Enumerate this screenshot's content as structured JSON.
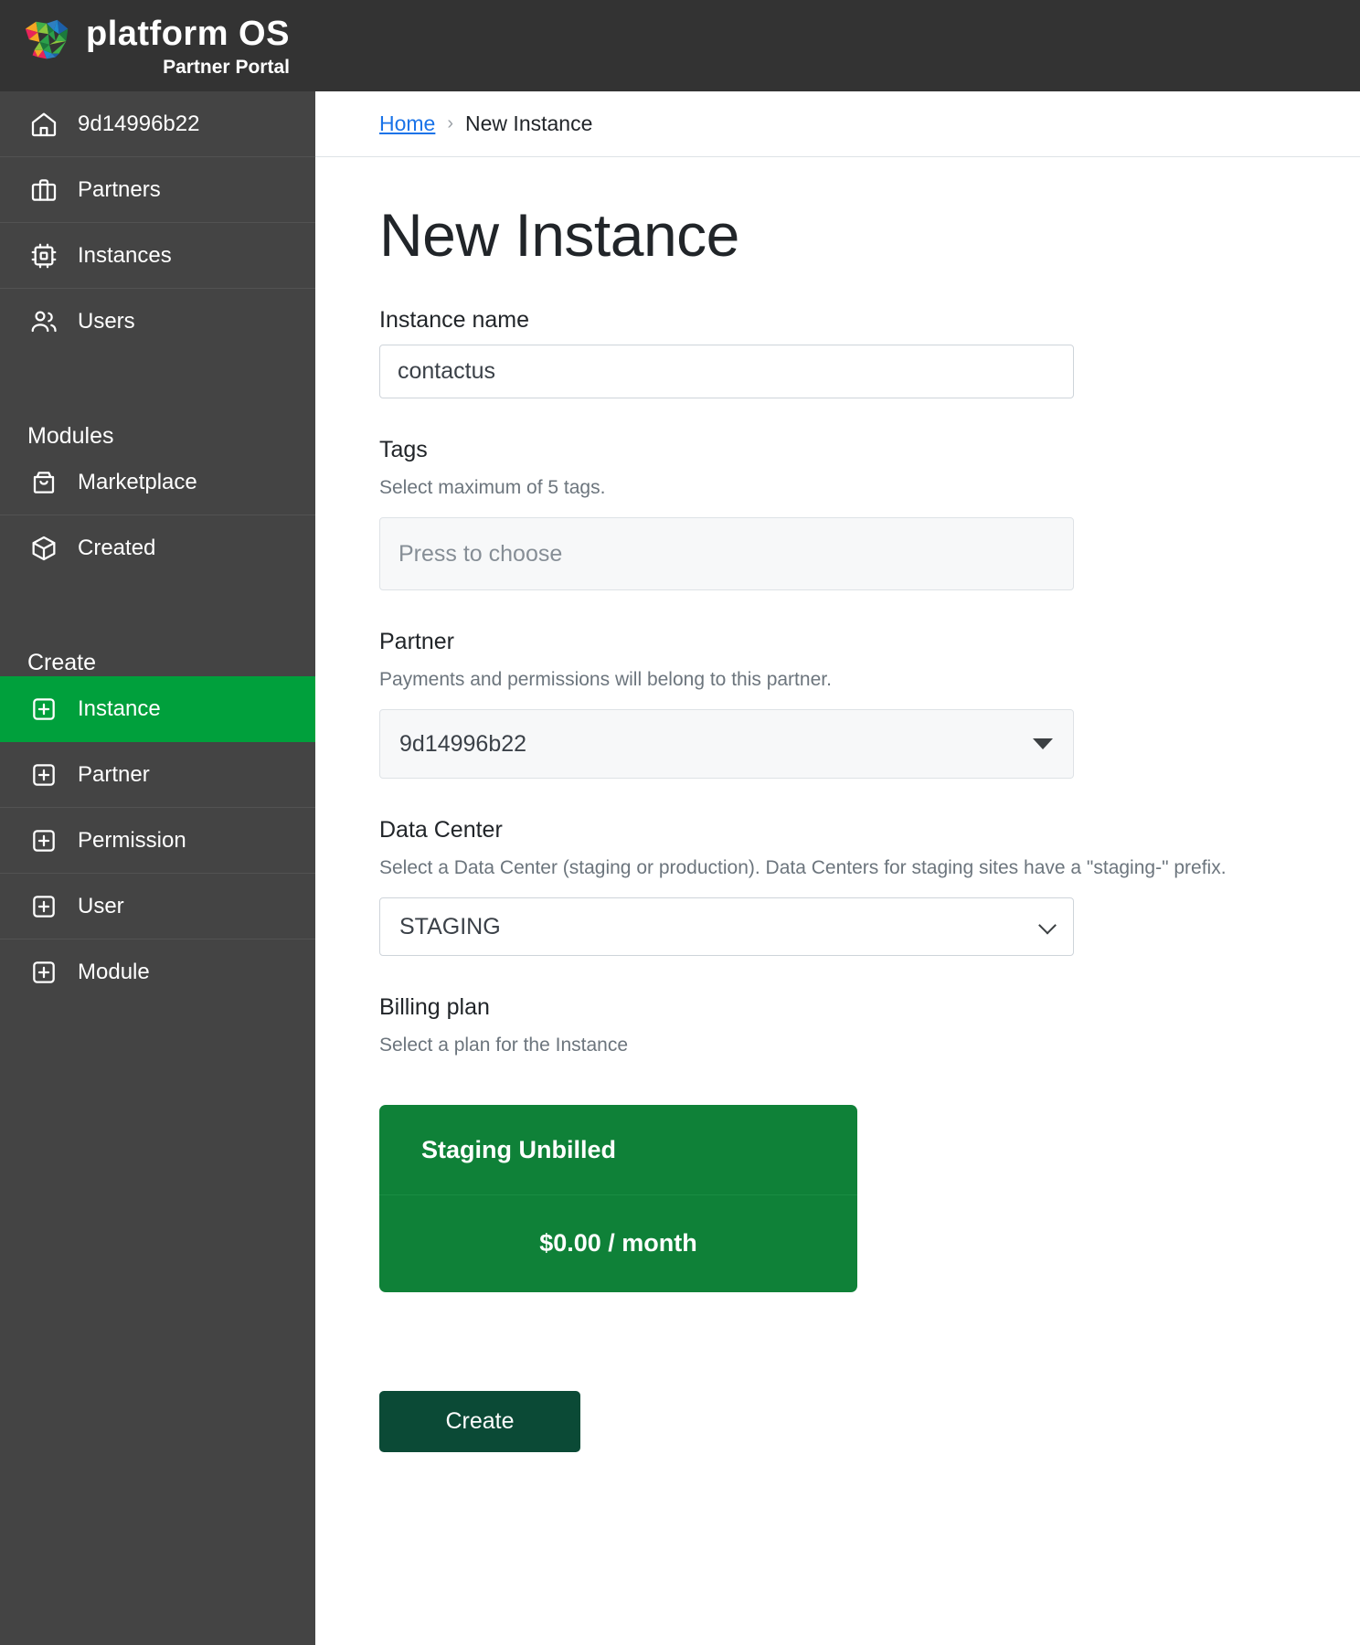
{
  "brand": {
    "name": "platform OS",
    "subtitle": "Partner Portal",
    "logo_icon": "chameleon-logo-icon",
    "bar_color": "#333333"
  },
  "sidebar": {
    "background": "#444444",
    "active_color": "#00a03c",
    "items": [
      {
        "label": "9d14996b22",
        "icon": "home-icon",
        "active": false
      },
      {
        "label": "Partners",
        "icon": "briefcase-icon",
        "active": false
      },
      {
        "label": "Instances",
        "icon": "chip-icon",
        "active": false
      },
      {
        "label": "Users",
        "icon": "users-icon",
        "active": false
      }
    ],
    "sections": [
      {
        "title": "Modules",
        "items": [
          {
            "label": "Marketplace",
            "icon": "shopping-bag-icon",
            "active": false
          },
          {
            "label": "Created",
            "icon": "cube-icon",
            "active": false
          }
        ]
      },
      {
        "title": "Create",
        "items": [
          {
            "label": "Instance",
            "icon": "plus-square-icon",
            "active": true
          },
          {
            "label": "Partner",
            "icon": "plus-square-icon",
            "active": false
          },
          {
            "label": "Permission",
            "icon": "plus-square-icon",
            "active": false
          },
          {
            "label": "User",
            "icon": "plus-square-icon",
            "active": false
          },
          {
            "label": "Module",
            "icon": "plus-square-icon",
            "active": false
          }
        ]
      }
    ]
  },
  "breadcrumb": {
    "home": "Home",
    "separator": "›",
    "current": "New Instance",
    "link_color": "#1a73e8"
  },
  "page": {
    "title": "New Instance"
  },
  "form": {
    "instance_name": {
      "label": "Instance name",
      "value": "contactus"
    },
    "tags": {
      "label": "Tags",
      "help": "Select maximum of 5 tags.",
      "placeholder": "Press to choose",
      "value": ""
    },
    "partner": {
      "label": "Partner",
      "help": "Payments and permissions will belong to this partner.",
      "value": "9d14996b22",
      "caret_icon": "triangle-down-icon"
    },
    "data_center": {
      "label": "Data Center",
      "help": "Select a Data Center (staging or production). Data Centers for staging sites have a \"staging-\" prefix.",
      "value": "STAGING",
      "caret_icon": "chevron-down-icon"
    },
    "billing_plan": {
      "label": "Billing plan",
      "help": "Select a plan for the Instance",
      "card": {
        "name": "Staging Unbilled",
        "price": "$0.00 / month",
        "color": "#0f8138"
      }
    },
    "submit_label": "Create",
    "submit_color": "#0b4a36"
  }
}
